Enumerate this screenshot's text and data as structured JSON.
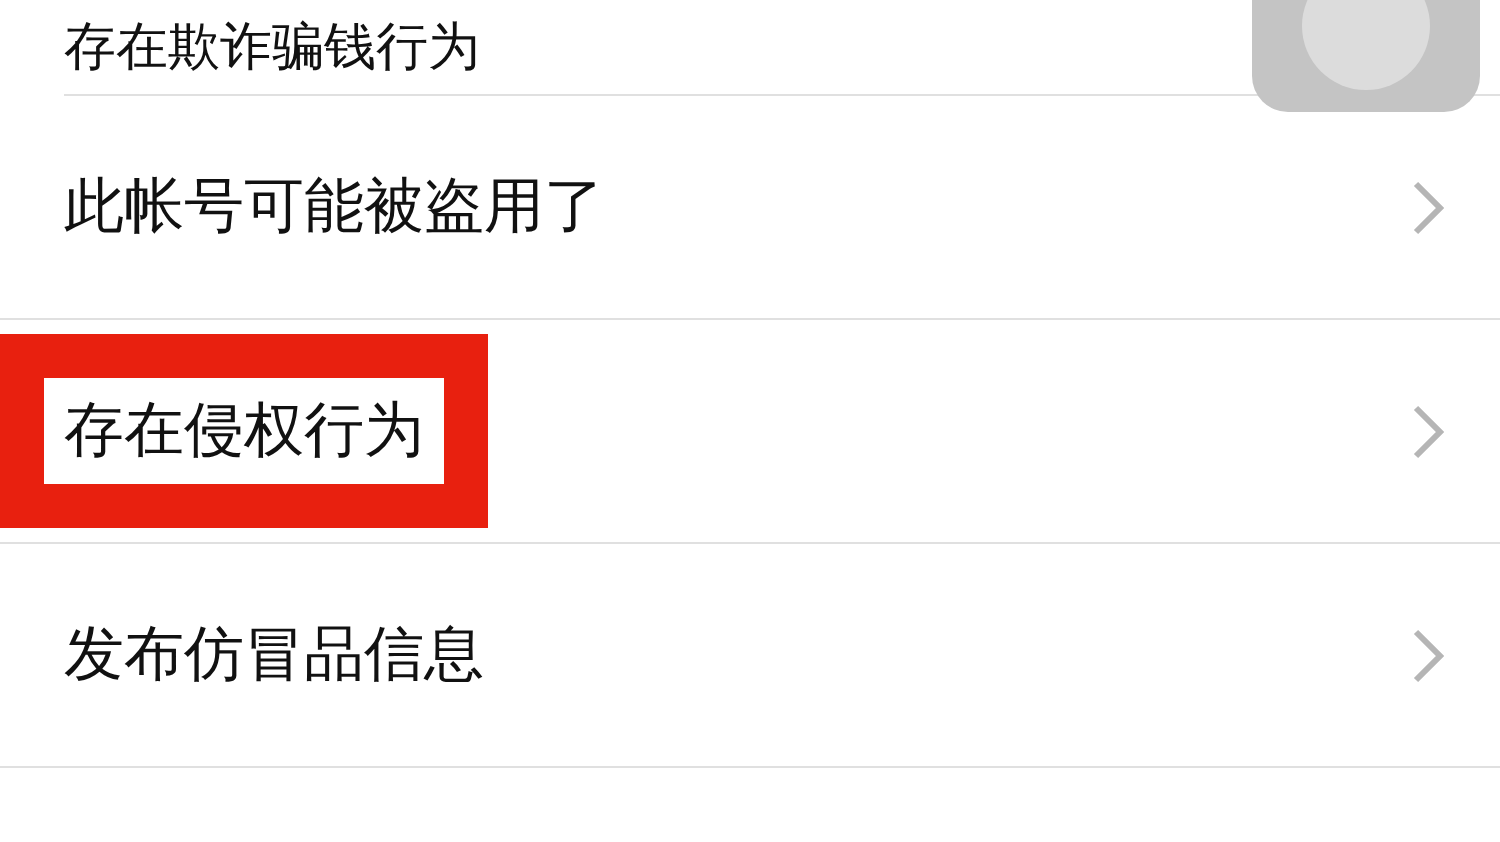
{
  "rows": [
    {
      "label": "存在欺诈骗钱行为",
      "highlighted": false,
      "partial": true
    },
    {
      "label": "此帐号可能被盗用了",
      "highlighted": false,
      "partial": false
    },
    {
      "label": "存在侵权行为",
      "highlighted": true,
      "partial": false
    },
    {
      "label": "发布仿冒品信息",
      "highlighted": false,
      "partial": false
    }
  ]
}
